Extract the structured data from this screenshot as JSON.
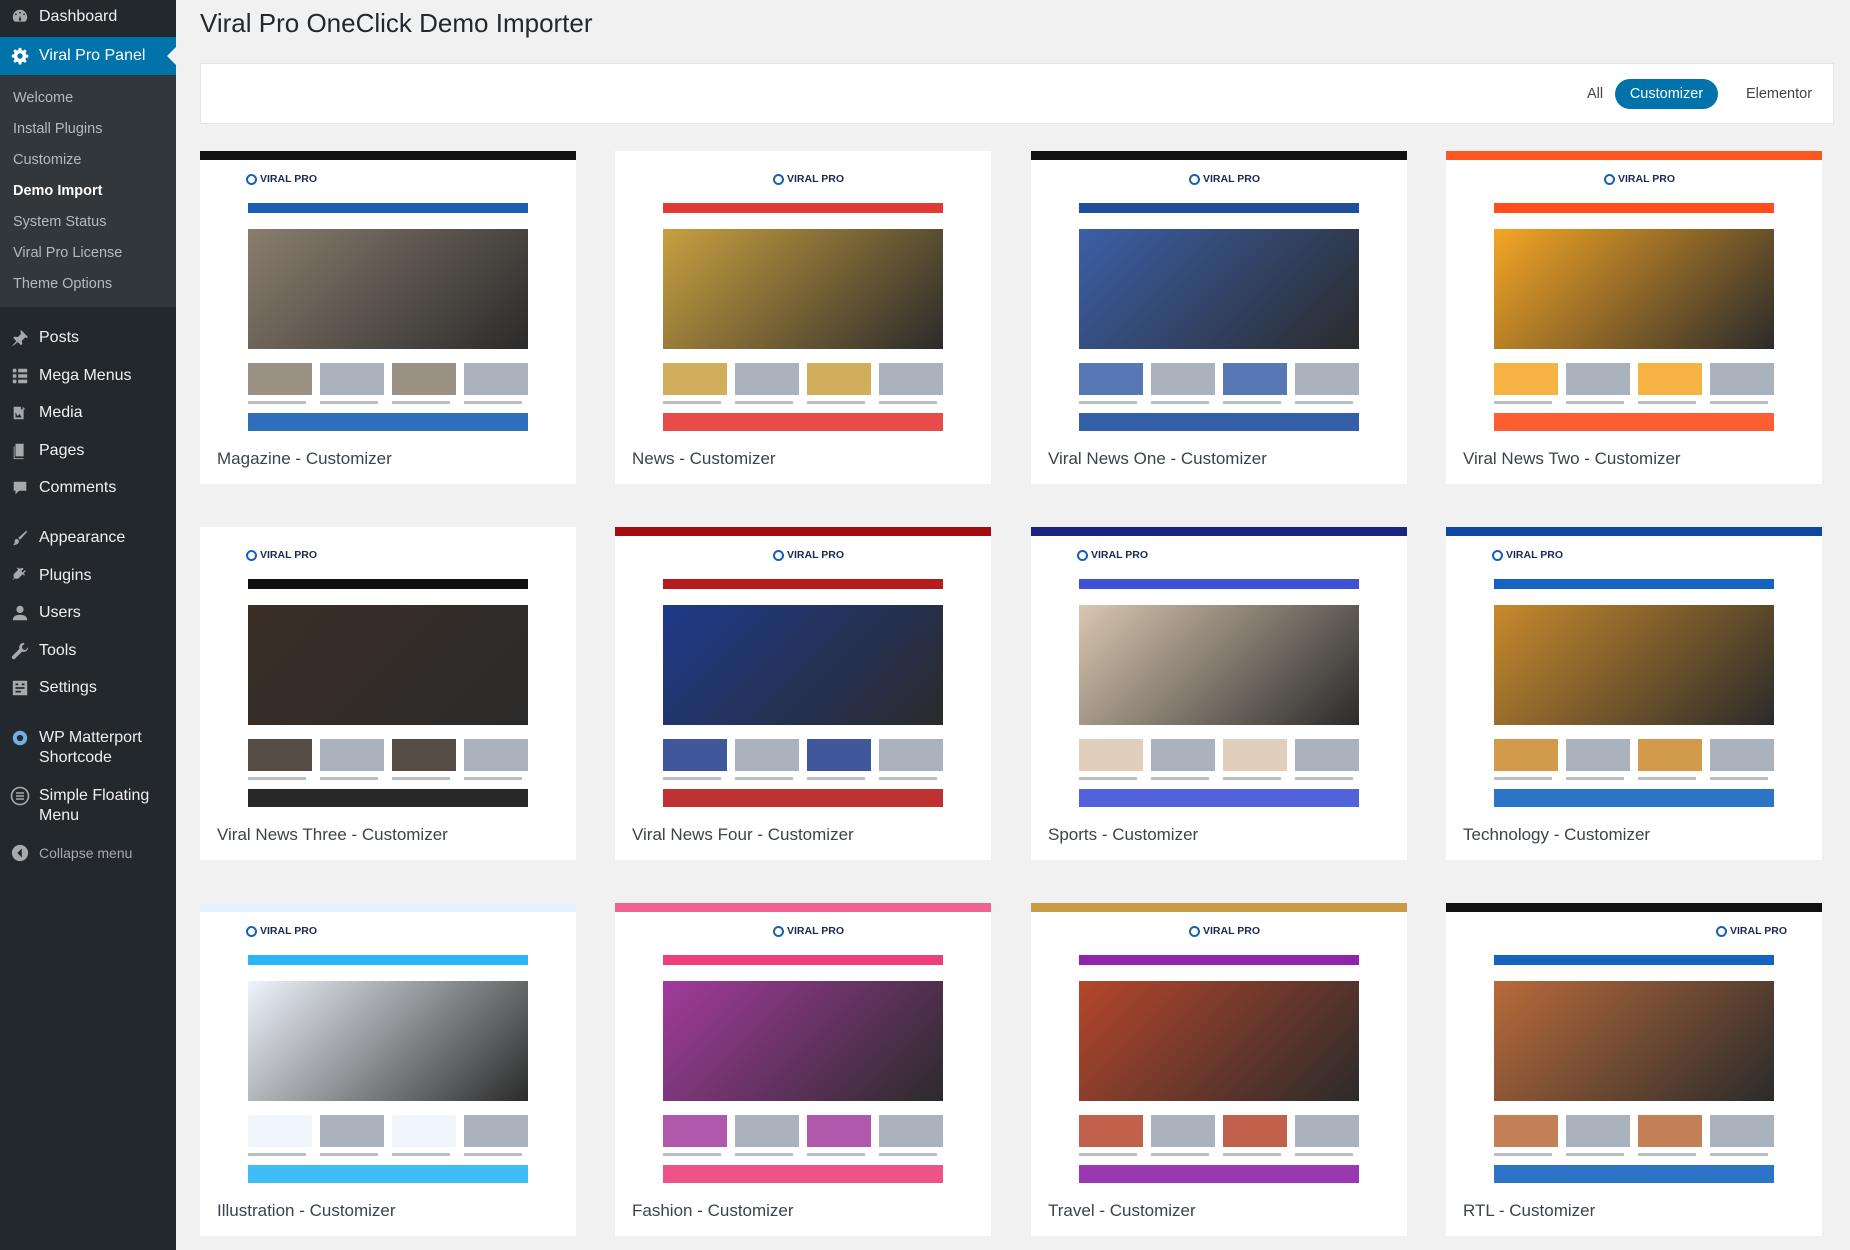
{
  "sidebar": {
    "top_items": [
      {
        "label": "Dashboard",
        "icon": "dashboard-icon"
      },
      {
        "label": "Viral Pro Panel",
        "icon": "gear-icon"
      }
    ],
    "submenu": [
      "Welcome",
      "Install Plugins",
      "Customize",
      "Demo Import",
      "System Status",
      "Viral Pro License",
      "Theme Options"
    ],
    "current_submenu": "Demo Import",
    "items": [
      {
        "label": "Posts",
        "icon": "pin-icon"
      },
      {
        "label": "Mega Menus",
        "icon": "grid-icon"
      },
      {
        "label": "Media",
        "icon": "media-icon"
      },
      {
        "label": "Pages",
        "icon": "pages-icon"
      },
      {
        "label": "Comments",
        "icon": "comment-icon"
      },
      {
        "label": "Appearance",
        "icon": "brush-icon"
      },
      {
        "label": "Plugins",
        "icon": "plug-icon"
      },
      {
        "label": "Users",
        "icon": "user-icon"
      },
      {
        "label": "Tools",
        "icon": "wrench-icon"
      },
      {
        "label": "Settings",
        "icon": "settings-icon"
      },
      {
        "label": "WP Matterport Shortcode",
        "line1": "WP Matterport",
        "line2": "Shortcode",
        "icon": "matterport-icon"
      },
      {
        "label": "Simple Floating Menu",
        "line1": "Simple Floating",
        "line2": "Menu",
        "icon": "menu-icon"
      }
    ],
    "collapse_label": "Collapse menu"
  },
  "page": {
    "title": "Viral Pro OneClick Demo Importer"
  },
  "filters": {
    "items": [
      "All",
      "Customizer",
      "Elementor"
    ],
    "active": "Customizer"
  },
  "demos": [
    {
      "title": "Magazine - Customizer",
      "accent": "#1a5fb4",
      "top": "#111111",
      "hero": "#8a7d6e"
    },
    {
      "title": "News - Customizer",
      "accent": "#e53935",
      "top": "#ffffff",
      "hero": "#c8a040"
    },
    {
      "title": "Viral News One - Customizer",
      "accent": "#1f4e9c",
      "top": "#111111",
      "hero": "#3b5fa8"
    },
    {
      "title": "Viral News Two - Customizer",
      "accent": "#ff4d1c",
      "top": "#ff5722",
      "hero": "#f5a623"
    },
    {
      "title": "Viral News Three - Customizer",
      "accent": "#111111",
      "top": "#ffffff",
      "hero": "#3a2e25"
    },
    {
      "title": "Viral News Four - Customizer",
      "accent": "#b71c1c",
      "top": "#a30d0d",
      "hero": "#1e3a8a"
    },
    {
      "title": "Sports - Customizer",
      "accent": "#3f51d6",
      "top": "#1a237e",
      "hero": "#d9c7b0"
    },
    {
      "title": "Technology - Customizer",
      "accent": "#1565c0",
      "top": "#0d47a1",
      "hero": "#c98a2c"
    },
    {
      "title": "Illustration - Customizer",
      "accent": "#29b6f6",
      "top": "#e3f2fd",
      "hero": "#eef4fb"
    },
    {
      "title": "Fashion - Customizer",
      "accent": "#ec407a",
      "top": "#f06292",
      "hero": "#a23b9c"
    },
    {
      "title": "Travel - Customizer",
      "accent": "#8e24aa",
      "top": "#c79b48",
      "hero": "#b5462b"
    },
    {
      "title": "RTL - Customizer",
      "accent": "#1565c0",
      "top": "#111111",
      "hero": "#b86a3a"
    }
  ],
  "brand_label": "VIRAL PRO"
}
